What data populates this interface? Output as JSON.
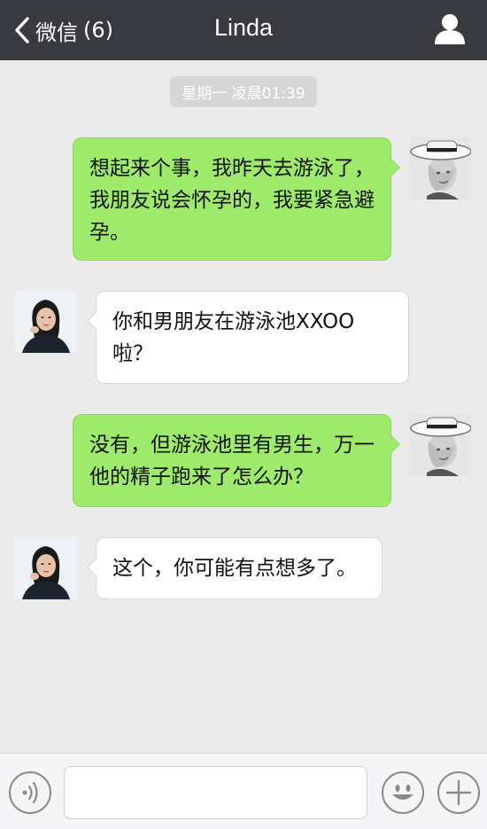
{
  "navbar": {
    "back_label": "微信",
    "unread_count": "(6)",
    "title": "Linda",
    "icons": {
      "back": "chevron-left-icon",
      "profile": "person-icon"
    }
  },
  "timestamp": "星期一 凌晨01:39",
  "messages": [
    {
      "sender": "me",
      "text": "想起来个事，我昨天去游泳了，我朋友说会怀孕的，我要紧急避孕。"
    },
    {
      "sender": "linda",
      "text": "你和男朋友在游泳池XXOO啦？"
    },
    {
      "sender": "me",
      "text": "没有，但游泳池里有男生，万一他的精子跑来了怎么办？"
    },
    {
      "sender": "linda",
      "text": "这个，你可能有点想多了。"
    }
  ],
  "input_bar": {
    "text_value": "",
    "icons": {
      "voice": "voice-icon",
      "emoji": "smiley-icon",
      "more": "plus-icon"
    }
  },
  "colors": {
    "navbar": "#393a3f",
    "background": "#ebebeb",
    "my_bubble": "#9eea6a",
    "their_bubble": "#ffffff"
  }
}
